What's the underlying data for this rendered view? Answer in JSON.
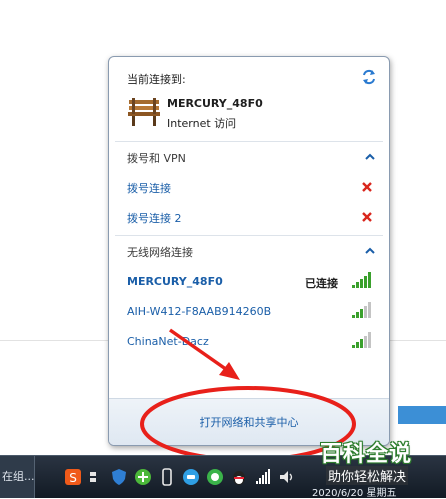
{
  "flyout": {
    "current_label": "当前连接到:",
    "current_network": {
      "name": "MERCURY_48F0",
      "access": "Internet 访问"
    },
    "dialup_group": {
      "title": "拨号和 VPN",
      "items": [
        {
          "label": "拨号连接"
        },
        {
          "label": "拨号连接 2"
        }
      ]
    },
    "wireless_group": {
      "title": "无线网络连接",
      "items": [
        {
          "label": "MERCURY_48F0",
          "status": "已连接",
          "signal_bars": 5
        },
        {
          "label": "AIH-W412-F8AAB914260B",
          "status": "",
          "signal_bars": 3
        },
        {
          "label": "ChinaNet-Dacz",
          "status": "",
          "signal_bars": 3
        }
      ]
    },
    "footer_link": "打开网络和共享中心"
  },
  "watermark": {
    "title": "百科全说",
    "subtitle": "助你轻松解决"
  },
  "taskbar": {
    "left_label": "在组...",
    "clock": "2020/6/20 星期五"
  },
  "colors": {
    "link_blue": "#1a5ea8",
    "remove_red": "#d9261c",
    "signal_green": "#3aa02c",
    "annotation_red": "#e8201a",
    "watermark_green": "#2d7d2d"
  }
}
